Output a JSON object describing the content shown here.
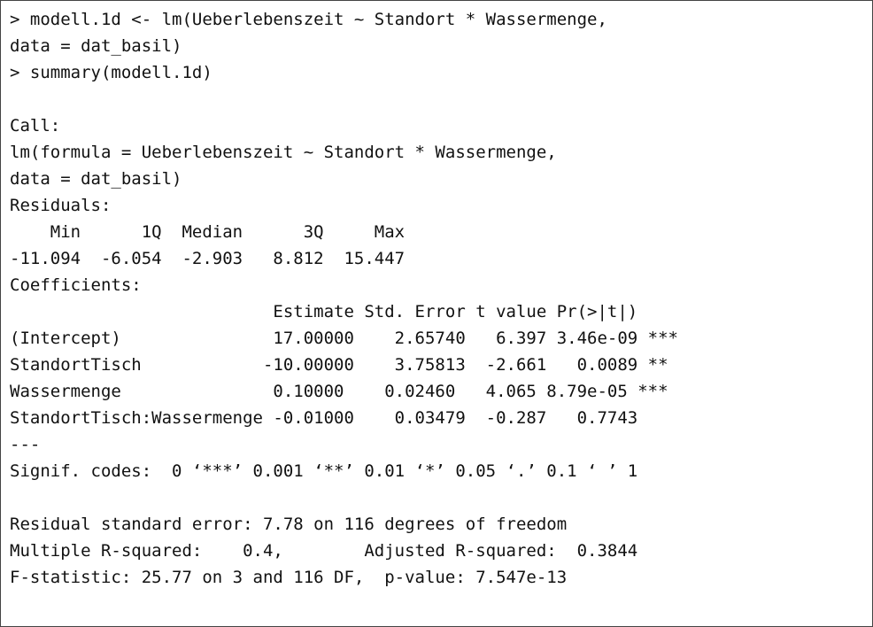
{
  "console": {
    "lines": [
      "> modell.1d <- lm(Ueberlebenszeit ~ Standort * Wassermenge,",
      "data = dat_basil)",
      "> summary(modell.1d)",
      "",
      "Call:",
      "lm(formula = Ueberlebenszeit ~ Standort * Wassermenge,",
      "data = dat_basil)",
      "Residuals:",
      "    Min      1Q  Median      3Q     Max",
      "-11.094  -6.054  -2.903   8.812  15.447",
      "Coefficients:",
      "                          Estimate Std. Error t value Pr(>|t|)",
      "(Intercept)               17.00000    2.65740   6.397 3.46e-09 ***",
      "StandortTisch            -10.00000    3.75813  -2.661   0.0089 **",
      "Wassermenge               0.10000    0.02460   4.065 8.79e-05 ***",
      "StandortTisch:Wassermenge -0.01000    0.03479  -0.287   0.7743",
      "---",
      "Signif. codes:  0 ‘***’ 0.001 ‘**’ 0.01 ‘*’ 0.05 ‘.’ 0.1 ‘ ’ 1",
      "",
      "Residual standard error: 7.78 on 116 degrees of freedom",
      "Multiple R-squared:    0.4,        Adjusted R-squared:  0.3844",
      "F-statistic: 25.77 on 3 and 116 DF,  p-value: 7.547e-13"
    ]
  }
}
